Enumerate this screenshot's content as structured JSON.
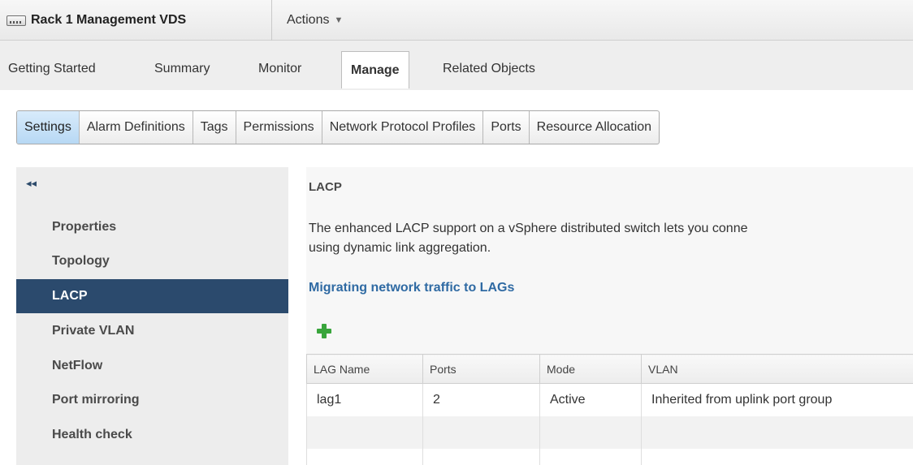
{
  "header": {
    "object_icon": "distributed-switch-icon",
    "object_title": "Rack 1 Management VDS",
    "actions_label": "Actions"
  },
  "primary_tabs": [
    {
      "label": "Getting Started"
    },
    {
      "label": "Summary"
    },
    {
      "label": "Monitor"
    },
    {
      "label": "Manage",
      "active": true
    },
    {
      "label": "Related Objects"
    }
  ],
  "sub_tabs": [
    {
      "label": "Settings",
      "active": true
    },
    {
      "label": "Alarm Definitions"
    },
    {
      "label": "Tags"
    },
    {
      "label": "Permissions"
    },
    {
      "label": "Network Protocol Profiles"
    },
    {
      "label": "Ports"
    },
    {
      "label": "Resource Allocation"
    }
  ],
  "sidenav": {
    "collapse_icon": "double-chevron-left-icon",
    "items": [
      {
        "label": "Properties"
      },
      {
        "label": "Topology"
      },
      {
        "label": "LACP",
        "active": true
      },
      {
        "label": "Private VLAN"
      },
      {
        "label": "NetFlow"
      },
      {
        "label": "Port mirroring"
      },
      {
        "label": "Health check"
      }
    ]
  },
  "panel": {
    "title": "LACP",
    "description_line1": "The enhanced LACP support on a vSphere distributed switch lets you conne",
    "description_line2": "using dynamic link aggregation.",
    "link_label": "Migrating network traffic to LAGs",
    "add_icon": "add-plus-icon",
    "table": {
      "columns": [
        "LAG Name",
        "Ports",
        "Mode",
        "VLAN"
      ],
      "rows": [
        [
          "lag1",
          "2",
          "Active",
          "Inherited from uplink port group"
        ]
      ]
    }
  },
  "colors": {
    "selected_nav_bg": "#2b4a6d",
    "link": "#2f6aa3",
    "add_icon": "#39a53c",
    "selected_subtab": "#c6e1f7"
  }
}
